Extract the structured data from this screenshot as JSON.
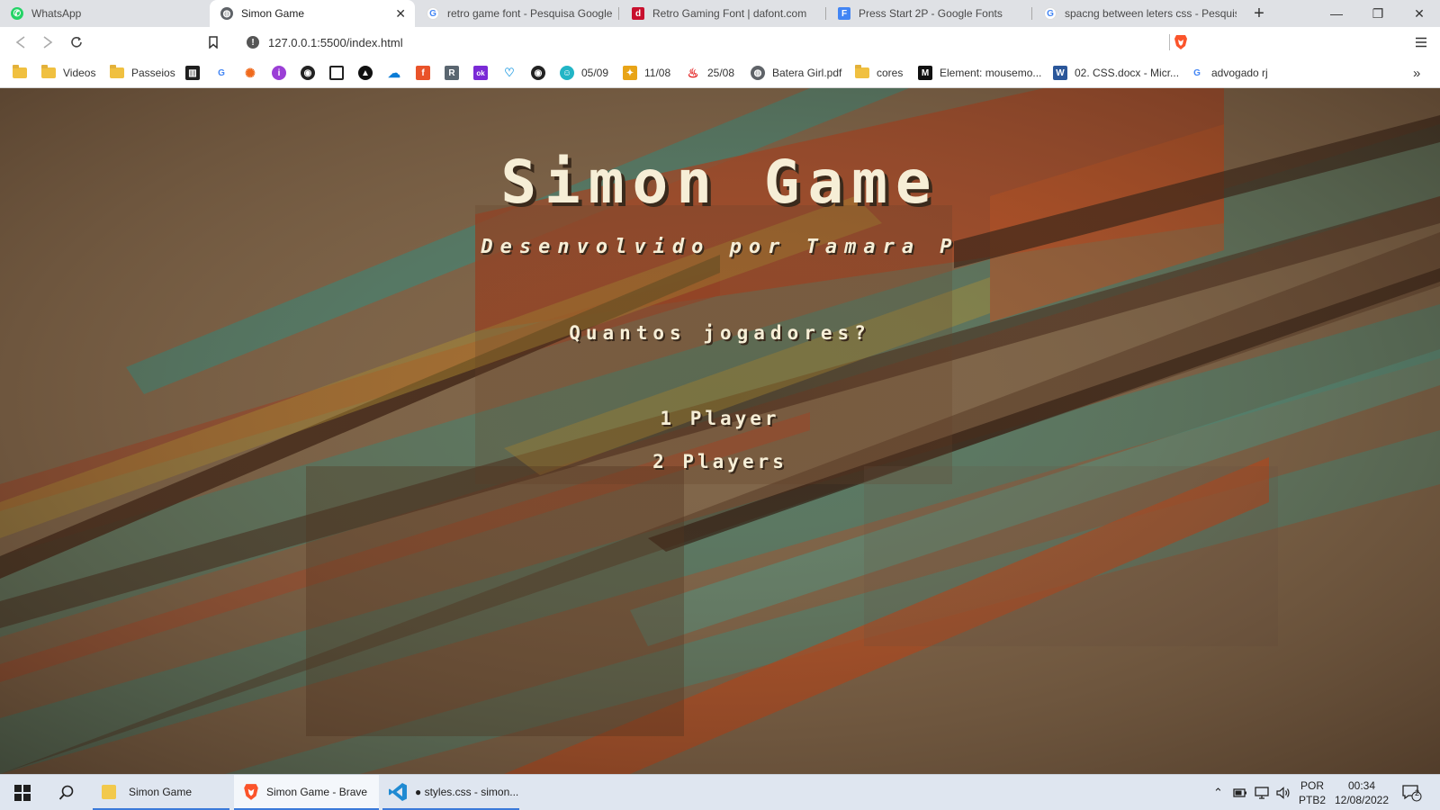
{
  "browser": {
    "tabs": [
      {
        "label": "WhatsApp",
        "icon": "whatsapp-icon",
        "active": false
      },
      {
        "label": "Simon Game",
        "icon": "globe-icon",
        "active": true
      },
      {
        "label": "retro game font - Pesquisa Google",
        "icon": "google-icon",
        "active": false
      },
      {
        "label": "Retro Gaming Font | dafont.com",
        "icon": "dafont-icon",
        "active": false
      },
      {
        "label": "Press Start 2P - Google Fonts",
        "icon": "google-fonts-icon",
        "active": false
      },
      {
        "label": "spacng between leters css - Pesquis",
        "icon": "google-icon",
        "active": false
      }
    ],
    "new_tab_label": "+",
    "window_controls": {
      "minimize": "—",
      "restore": "❐",
      "close": "✕"
    },
    "url": "127.0.0.1:5500/index.html",
    "bookmarks": [
      {
        "label": "Videos",
        "icon": "folder-icon"
      },
      {
        "label": "Passeios",
        "icon": "folder-icon"
      },
      {
        "label": "05/09",
        "icon": "chat-icon"
      },
      {
        "label": "11/08",
        "icon": "ticket-icon"
      },
      {
        "label": "25/08",
        "icon": "santander-icon"
      },
      {
        "label": "Batera Girl.pdf",
        "icon": "globe-icon"
      },
      {
        "label": "cores",
        "icon": "folder-icon"
      },
      {
        "label": "Element: mousemo...",
        "icon": "mdn-icon"
      },
      {
        "label": "02. CSS.docx - Micr...",
        "icon": "word-icon"
      },
      {
        "label": "advogado rj",
        "icon": "google-icon"
      }
    ],
    "overflow_label": "»"
  },
  "game": {
    "title": "Simon Game",
    "subtitle": "Desenvolvido por Tamara P",
    "question": "Quantos jogadores?",
    "options": [
      "1 Player",
      "2 Players"
    ],
    "text_color": "#f6eed6"
  },
  "taskbar": {
    "apps": [
      {
        "label": "Simon Game",
        "icon": "file-explorer-icon"
      },
      {
        "label": "Simon Game - Brave",
        "icon": "brave-icon",
        "active": true
      },
      {
        "label": "● styles.css - simon...",
        "icon": "vscode-icon"
      }
    ],
    "language": "POR",
    "layout": "PTB2",
    "time": "00:34",
    "date": "12/08/2022",
    "notifications": "2"
  }
}
